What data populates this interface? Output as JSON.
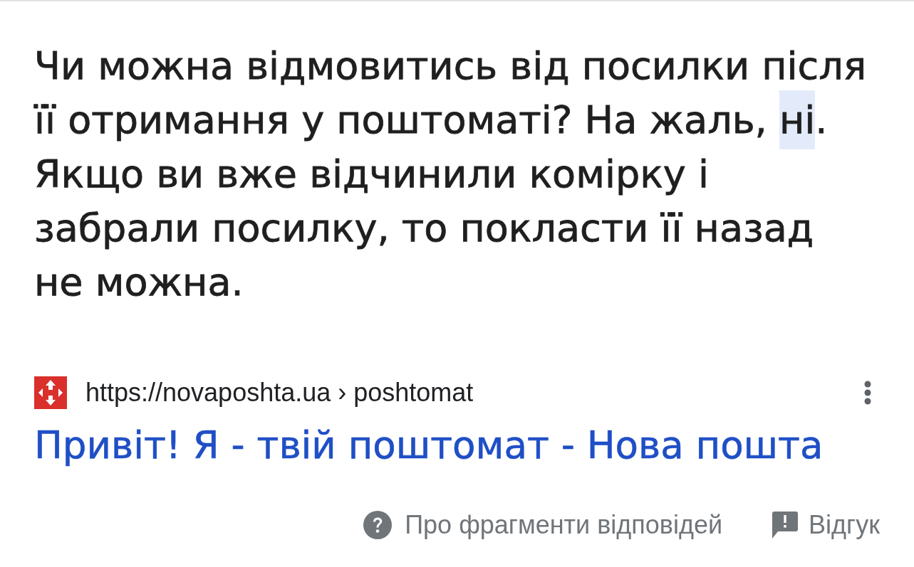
{
  "answer": {
    "segments": [
      {
        "text": "Чи можна відмовитись від посилки після її отримання у поштоматі? На жаль, ",
        "highlighted": false
      },
      {
        "text": "ні",
        "highlighted": true
      },
      {
        "text": ". Якщо ви вже відчинили комірку і забрали посилку, то покласти її назад не можна.",
        "highlighted": false
      }
    ]
  },
  "source": {
    "url": "https://novaposhta.ua › poshtomat",
    "title": "Привіт! Я - твій поштомат - Нова пошта"
  },
  "footer_links": [
    {
      "kind": "help",
      "label": "Про фрагменти відповідей"
    },
    {
      "kind": "feedback",
      "label": "Відгук"
    }
  ]
}
